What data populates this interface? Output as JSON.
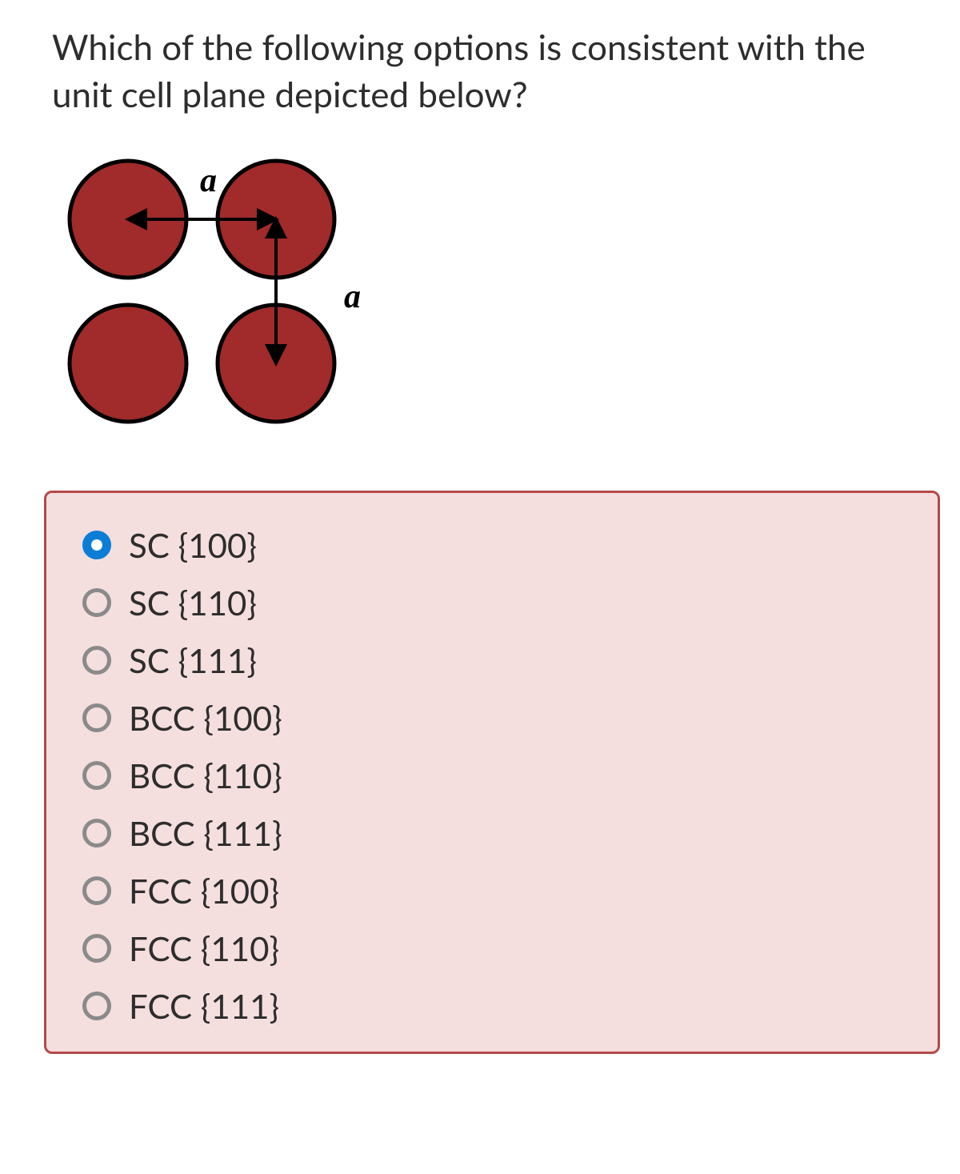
{
  "question": "Which of the following options is consistent with the unit cell plane depicted below?",
  "diagram": {
    "label_top": "a",
    "label_right": "a"
  },
  "options": [
    {
      "label": "SC {100}",
      "selected": true
    },
    {
      "label": "SC {110}",
      "selected": false
    },
    {
      "label": "SC {111}",
      "selected": false
    },
    {
      "label": "BCC {100}",
      "selected": false
    },
    {
      "label": "BCC {110}",
      "selected": false
    },
    {
      "label": "BCC {111}",
      "selected": false
    },
    {
      "label": "FCC {100}",
      "selected": false
    },
    {
      "label": "FCC {110}",
      "selected": false
    },
    {
      "label": "FCC {111}",
      "selected": false
    }
  ]
}
